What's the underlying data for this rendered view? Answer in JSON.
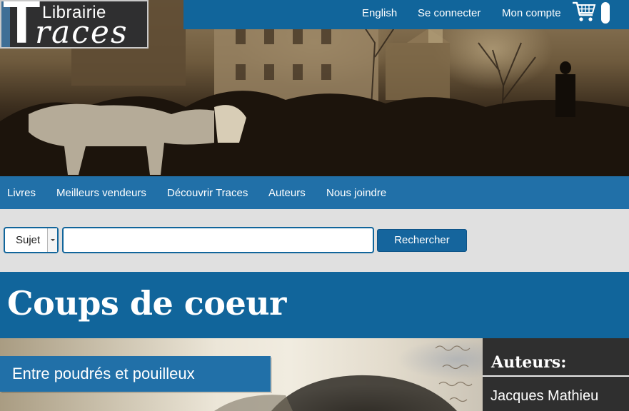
{
  "logo": {
    "word_top": "Librairie",
    "big_letter": "T",
    "word_bottom": "races"
  },
  "topbar": {
    "language": "English",
    "login": "Se connecter",
    "account": "Mon compte",
    "cart_icon": "shopping-cart-icon"
  },
  "mainnav": {
    "items": [
      {
        "label": "Livres"
      },
      {
        "label": "Meilleurs vendeurs"
      },
      {
        "label": "Découvrir Traces"
      },
      {
        "label": "Auteurs"
      },
      {
        "label": "Nous joindre"
      }
    ]
  },
  "search": {
    "subject_selected": "Sujet",
    "query_value": "",
    "button_label": "Rechercher"
  },
  "page": {
    "title": "Coups de coeur"
  },
  "feature": {
    "title": "Entre poudrés et pouilleux"
  },
  "authors": {
    "heading": "Auteurs:",
    "items": [
      "Jacques Mathieu"
    ]
  },
  "colors": {
    "brand_blue": "#11659b",
    "nav_blue": "#2170a8",
    "search_band": "#e0e0e0",
    "panel_dark": "#2f2f2f"
  }
}
